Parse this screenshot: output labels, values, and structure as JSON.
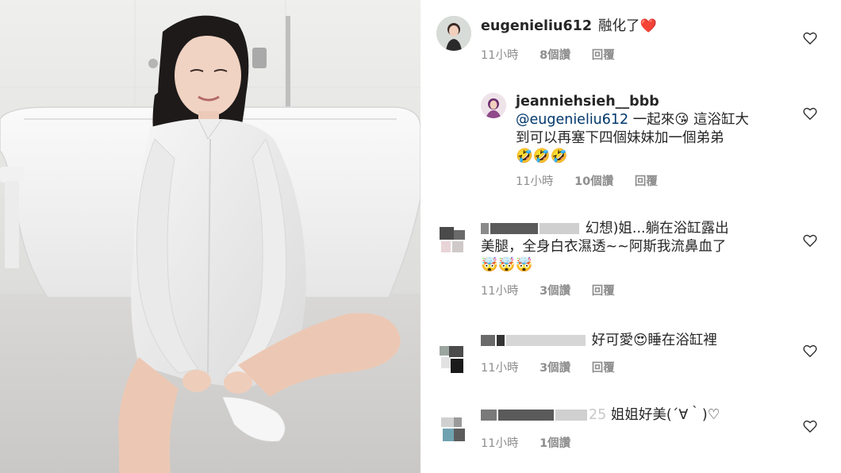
{
  "comments": [
    {
      "username": "eugenieliu612",
      "text": "融化了",
      "emoji": "❤️",
      "time": "11小時",
      "likes": "8個讚",
      "reply": "回覆"
    },
    {
      "username": "jeanniehsieh__bbb",
      "mention": "@eugenieliu612",
      "text_line1": " 一起來😘 這浴缸大",
      "text_line2": "到可以再塞下四個妹妹加一個弟弟",
      "emoji_line": "🤣🤣🤣",
      "time": "11小時",
      "likes": "10個讚",
      "reply": "回覆"
    },
    {
      "username_partial": "幻想)姐...躺在浴缸露出",
      "text_line2": "美腿，全身白衣濕透~~阿斯我流鼻血了",
      "emoji_line": "🤯🤯🤯",
      "time": "11小時",
      "likes": "3個讚",
      "reply": "回覆"
    },
    {
      "text": "好可愛",
      "emoji": "😍",
      "text_after": "睡在浴缸裡",
      "time": "11小時",
      "likes": "3個讚",
      "reply": "回覆"
    },
    {
      "username_partial": "25",
      "text": "姐姐好美(´∀｀)♡",
      "time": "11小時",
      "likes": "1個讚",
      "reply": "回覆"
    }
  ]
}
